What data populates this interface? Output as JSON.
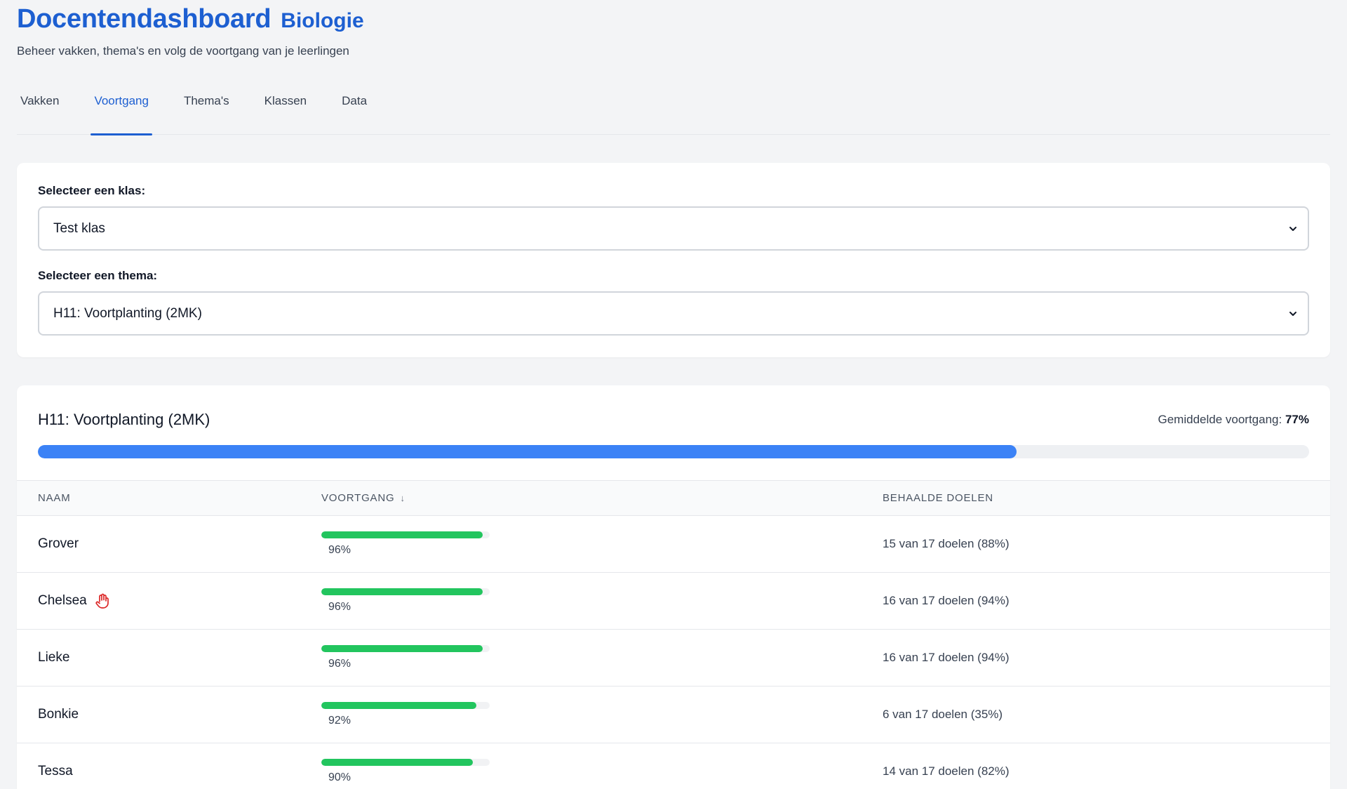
{
  "header": {
    "title": "Docentendashboard",
    "subject": "Biologie",
    "subtitle": "Beheer vakken, thema's en volg de voortgang van je leerlingen"
  },
  "tabs": [
    {
      "label": "Vakken",
      "active": false
    },
    {
      "label": "Voortgang",
      "active": true
    },
    {
      "label": "Thema's",
      "active": false
    },
    {
      "label": "Klassen",
      "active": false
    },
    {
      "label": "Data",
      "active": false
    }
  ],
  "selection": {
    "class_label": "Selecteer een klas:",
    "class_value": "Test klas",
    "theme_label": "Selecteer een thema:",
    "theme_value": "H11: Voortplanting (2MK)"
  },
  "progress": {
    "title": "H11: Voortplanting (2MK)",
    "average_label": "Gemiddelde voortgang:",
    "average_value": "77%",
    "average_fraction": 0.77,
    "columns": {
      "name": "NAAM",
      "progress": "VOORTGANG",
      "sort_indicator": "↓",
      "goals": "BEHAALDE DOELEN"
    },
    "students": [
      {
        "name": "Grover",
        "progress": "96%",
        "fraction": 0.96,
        "goals": "15 van 17 doelen (88%)",
        "hand_raised": false
      },
      {
        "name": "Chelsea",
        "progress": "96%",
        "fraction": 0.96,
        "goals": "16 van 17 doelen (94%)",
        "hand_raised": true
      },
      {
        "name": "Lieke",
        "progress": "96%",
        "fraction": 0.96,
        "goals": "16 van 17 doelen (94%)",
        "hand_raised": false
      },
      {
        "name": "Bonkie",
        "progress": "92%",
        "fraction": 0.92,
        "goals": "6 van 17 doelen (35%)",
        "hand_raised": false
      },
      {
        "name": "Tessa",
        "progress": "90%",
        "fraction": 0.9,
        "goals": "14 van 17 doelen (82%)",
        "hand_raised": false
      }
    ]
  },
  "colors": {
    "accent": "#1d5fd1",
    "overall_bar": "#3b82f6",
    "student_bar": "#22c55e",
    "hand_icon": "#dc2626"
  },
  "icons": {
    "select_arrow": "chevron-down-icon",
    "hand": "raised-hand-icon"
  }
}
